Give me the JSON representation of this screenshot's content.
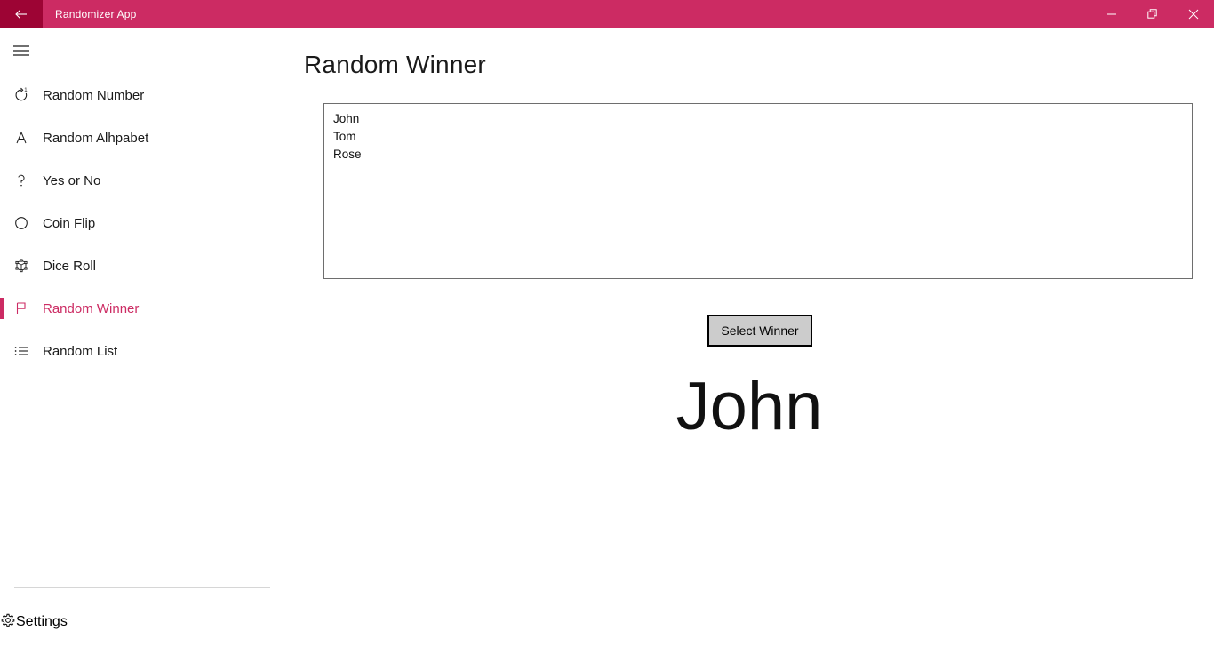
{
  "window": {
    "title": "Randomizer App",
    "back_icon": "back-arrow-icon",
    "minimize_label": "Minimize",
    "restore_label": "Restore",
    "close_label": "Close",
    "titlebar_color": "#cc2b63",
    "back_button_color": "#9d0434"
  },
  "sidebar": {
    "menu_icon": "hamburger-menu-icon",
    "accent_color": "#cc2b63",
    "items": [
      {
        "label": "Random Number",
        "icon": "repeat-one-icon",
        "selected": false
      },
      {
        "label": "Random Alhpabet",
        "icon": "letter-a-icon",
        "selected": false
      },
      {
        "label": "Yes or No",
        "icon": "question-mark-icon",
        "selected": false
      },
      {
        "label": "Coin Flip",
        "icon": "circle-icon",
        "selected": false
      },
      {
        "label": "Dice Roll",
        "icon": "cube-icon",
        "selected": false
      },
      {
        "label": "Random Winner",
        "icon": "flag-icon",
        "selected": true
      },
      {
        "label": "Random List",
        "icon": "bulleted-list-icon",
        "selected": false
      }
    ],
    "settings": {
      "label": "Settings",
      "icon": "gear-icon"
    }
  },
  "main": {
    "page_title": "Random Winner",
    "names_input": {
      "value": "John\nTom\nRose",
      "placeholder": ""
    },
    "select_button_label": "Select Winner",
    "result": "John"
  }
}
